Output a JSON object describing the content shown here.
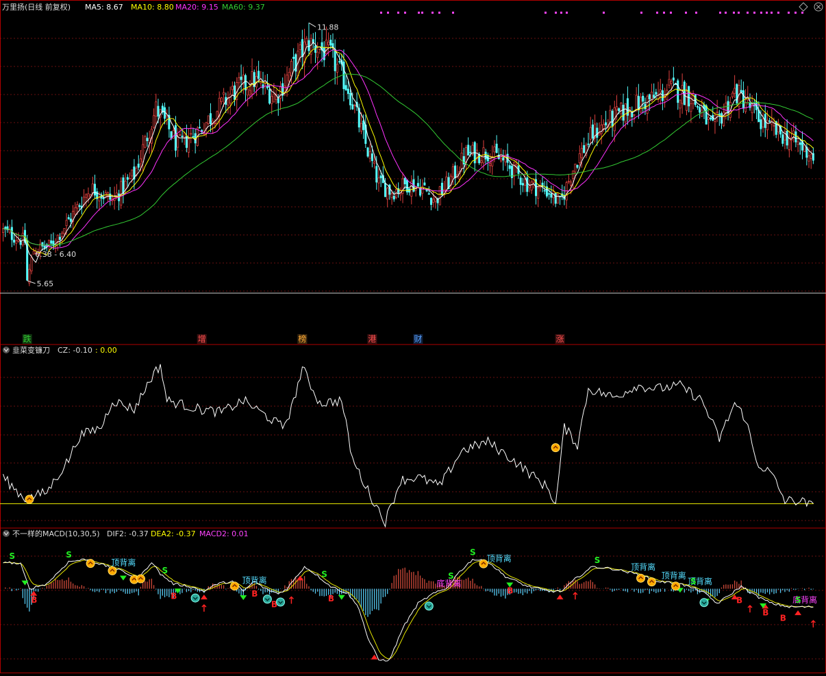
{
  "colors": {
    "up": "#e0413e",
    "down": "#54fcfc",
    "ma5": "#ffffff",
    "ma10": "#ffff00",
    "ma20": "#ff33ff",
    "ma60": "#33cc33",
    "border": "#b00000",
    "grid": "#6a1010",
    "magenta": "#ff44ff",
    "cyan": "#44e0ff",
    "green": "#22ee22",
    "red": "#ff2222",
    "orange": "#ffaa00",
    "zeroLine": "#e6e600"
  },
  "panel1": {
    "title": "万里扬(日线 前复权)",
    "legend": [
      {
        "label": "MA5: 8.67",
        "color": "#ffffff"
      },
      {
        "label": "MA10: 8.80",
        "color": "#ffff00"
      },
      {
        "label": "MA20: 9.15",
        "color": "#ff33ff"
      },
      {
        "label": "MA60: 9.37",
        "color": "#33cc33"
      }
    ],
    "high_label": "11.88",
    "low_label": "5.65",
    "range_label": "6.38 - 6.40",
    "events": [
      {
        "label": "跌",
        "color": "#33cc33",
        "bg": "#103810",
        "day": 11
      },
      {
        "label": "增",
        "color": "#ff5050",
        "bg": "#3a1010",
        "day": 91
      },
      {
        "label": "榜",
        "color": "#ffaa33",
        "bg": "#3a2810",
        "day": 137
      },
      {
        "label": "港",
        "color": "#ff5050",
        "bg": "#3a1010",
        "day": 169
      },
      {
        "label": "财",
        "color": "#55a0ff",
        "bg": "#10203a",
        "day": 190
      },
      {
        "label": "涨",
        "color": "#ff5050",
        "bg": "#3a1010",
        "day": 255
      }
    ]
  },
  "panel2": {
    "title": "韭菜变镰刀",
    "legend": [
      {
        "label": "CZ: -0.10",
        "color": "#dddddd"
      },
      {
        "label": ": 0.00",
        "color": "#ffff00"
      }
    ]
  },
  "panel3": {
    "title": "不一样的MACD(10,30,5)",
    "legend": [
      {
        "label": "DIF2: -0.37",
        "color": "#dddddd"
      },
      {
        "label": "DEA2: -0.37",
        "color": "#ffff00"
      },
      {
        "label": "MACD2: 0.01",
        "color": "#ff44ff"
      }
    ],
    "divergence_labels": [
      {
        "text": "顶背离",
        "color": "#55ddff",
        "day": 52
      },
      {
        "text": "顶背离",
        "color": "#55ddff",
        "day": 112
      },
      {
        "text": "底背离",
        "color": "#ff44ff",
        "day": 201
      },
      {
        "text": "顶背离",
        "color": "#55ddff",
        "day": 224
      },
      {
        "text": "顶背离",
        "color": "#55ddff",
        "day": 290
      },
      {
        "text": "顶背离",
        "color": "#55ddff",
        "day": 304
      },
      {
        "text": "顶背离",
        "color": "#55ddff",
        "day": 316
      },
      {
        "text": "底背离",
        "color": "#ff44ff",
        "day": 364
      }
    ],
    "buy_label": "B",
    "sell_label": "S"
  },
  "chart_data": {
    "type": "candlestick",
    "days": 372,
    "key_prices": {
      "high": 11.88,
      "low": 5.65
    },
    "y_range": [
      5.35,
      12.1
    ],
    "price_path": [
      [
        0,
        6.85
      ],
      [
        10,
        6.6
      ],
      [
        11,
        5.65
      ],
      [
        14,
        6.39
      ],
      [
        22,
        6.5
      ],
      [
        30,
        7.1
      ],
      [
        40,
        7.9
      ],
      [
        50,
        7.6
      ],
      [
        60,
        8.2
      ],
      [
        70,
        9.8
      ],
      [
        75,
        9.4
      ],
      [
        80,
        8.9
      ],
      [
        90,
        9.3
      ],
      [
        105,
        10.2
      ],
      [
        115,
        10.5
      ],
      [
        125,
        10.1
      ],
      [
        137,
        11.2
      ],
      [
        140,
        11.4
      ],
      [
        150,
        11.1
      ],
      [
        158,
        10.3
      ],
      [
        165,
        9.1
      ],
      [
        172,
        8.0
      ],
      [
        178,
        7.8
      ],
      [
        185,
        8.0
      ],
      [
        192,
        7.9
      ],
      [
        198,
        7.6
      ],
      [
        205,
        8.1
      ],
      [
        212,
        8.7
      ],
      [
        222,
        8.75
      ],
      [
        230,
        8.5
      ],
      [
        240,
        8.0
      ],
      [
        250,
        7.8
      ],
      [
        255,
        7.5
      ],
      [
        262,
        8.5
      ],
      [
        270,
        9.2
      ],
      [
        280,
        9.6
      ],
      [
        290,
        9.9
      ],
      [
        300,
        10.1
      ],
      [
        305,
        10.3
      ],
      [
        315,
        10.1
      ],
      [
        325,
        9.3
      ],
      [
        335,
        10.2
      ],
      [
        340,
        10.0
      ],
      [
        345,
        9.6
      ],
      [
        352,
        9.3
      ],
      [
        360,
        9.1
      ],
      [
        371,
        8.67
      ]
    ],
    "ma5_last": 8.67,
    "ma10_last": 8.8,
    "ma20_last": 9.15,
    "ma60_last": 9.37,
    "cz_path": [
      [
        0,
        0.9
      ],
      [
        10,
        0.15
      ],
      [
        20,
        0.4
      ],
      [
        30,
        1.5
      ],
      [
        35,
        2.3
      ],
      [
        45,
        2.6
      ],
      [
        50,
        3.5
      ],
      [
        60,
        3.2
      ],
      [
        68,
        4.3
      ],
      [
        72,
        4.7
      ],
      [
        75,
        3.5
      ],
      [
        90,
        3.2
      ],
      [
        100,
        3.1
      ],
      [
        110,
        3.5
      ],
      [
        120,
        3.0
      ],
      [
        128,
        2.6
      ],
      [
        132,
        3.2
      ],
      [
        137,
        4.6
      ],
      [
        145,
        3.4
      ],
      [
        155,
        3.5
      ],
      [
        160,
        1.5
      ],
      [
        168,
        0.3
      ],
      [
        175,
        -0.6
      ],
      [
        182,
        0.8
      ],
      [
        190,
        0.9
      ],
      [
        200,
        0.6
      ],
      [
        210,
        1.8
      ],
      [
        222,
        2.1
      ],
      [
        235,
        1.4
      ],
      [
        250,
        0.5
      ],
      [
        253,
        -0.05
      ],
      [
        257,
        2.6
      ],
      [
        263,
        2.0
      ],
      [
        268,
        3.9
      ],
      [
        280,
        3.6
      ],
      [
        290,
        4.0
      ],
      [
        300,
        3.9
      ],
      [
        310,
        4.0
      ],
      [
        320,
        3.5
      ],
      [
        328,
        2.2
      ],
      [
        335,
        3.4
      ],
      [
        340,
        2.9
      ],
      [
        345,
        1.4
      ],
      [
        352,
        1.0
      ],
      [
        358,
        0.1
      ],
      [
        365,
        0.1
      ],
      [
        371,
        -0.1
      ]
    ],
    "cz_zero": 0.0,
    "dif_path": [
      [
        0,
        0.55
      ],
      [
        8,
        0.5
      ],
      [
        12,
        0.0
      ],
      [
        20,
        0.1
      ],
      [
        30,
        0.55
      ],
      [
        38,
        0.6
      ],
      [
        48,
        0.45
      ],
      [
        55,
        0.35
      ],
      [
        62,
        0.2
      ],
      [
        68,
        0.55
      ],
      [
        72,
        0.3
      ],
      [
        78,
        0.1
      ],
      [
        85,
        0.05
      ],
      [
        92,
        -0.05
      ],
      [
        98,
        0.1
      ],
      [
        105,
        0.15
      ],
      [
        110,
        -0.05
      ],
      [
        115,
        0.15
      ],
      [
        120,
        0.0
      ],
      [
        126,
        -0.1
      ],
      [
        130,
        0.0
      ],
      [
        138,
        0.45
      ],
      [
        143,
        0.3
      ],
      [
        150,
        0.05
      ],
      [
        158,
        -0.1
      ],
      [
        163,
        -0.4
      ],
      [
        167,
        -1.0
      ],
      [
        172,
        -1.45
      ],
      [
        177,
        -1.45
      ],
      [
        183,
        -0.8
      ],
      [
        190,
        -0.3
      ],
      [
        197,
        -0.1
      ],
      [
        203,
        0.0
      ],
      [
        208,
        0.3
      ],
      [
        215,
        0.6
      ],
      [
        222,
        0.55
      ],
      [
        230,
        0.25
      ],
      [
        240,
        0.05
      ],
      [
        250,
        -0.05
      ],
      [
        256,
        -0.05
      ],
      [
        262,
        0.2
      ],
      [
        270,
        0.45
      ],
      [
        280,
        0.4
      ],
      [
        290,
        0.3
      ],
      [
        300,
        0.15
      ],
      [
        310,
        0.1
      ],
      [
        320,
        -0.05
      ],
      [
        327,
        -0.3
      ],
      [
        332,
        -0.15
      ],
      [
        338,
        0.05
      ],
      [
        345,
        -0.15
      ],
      [
        352,
        -0.3
      ],
      [
        360,
        -0.37
      ],
      [
        371,
        -0.37
      ]
    ],
    "macd_bars": "histogram of DIF2-DEA2, values within [-0.3, 0.3]"
  }
}
